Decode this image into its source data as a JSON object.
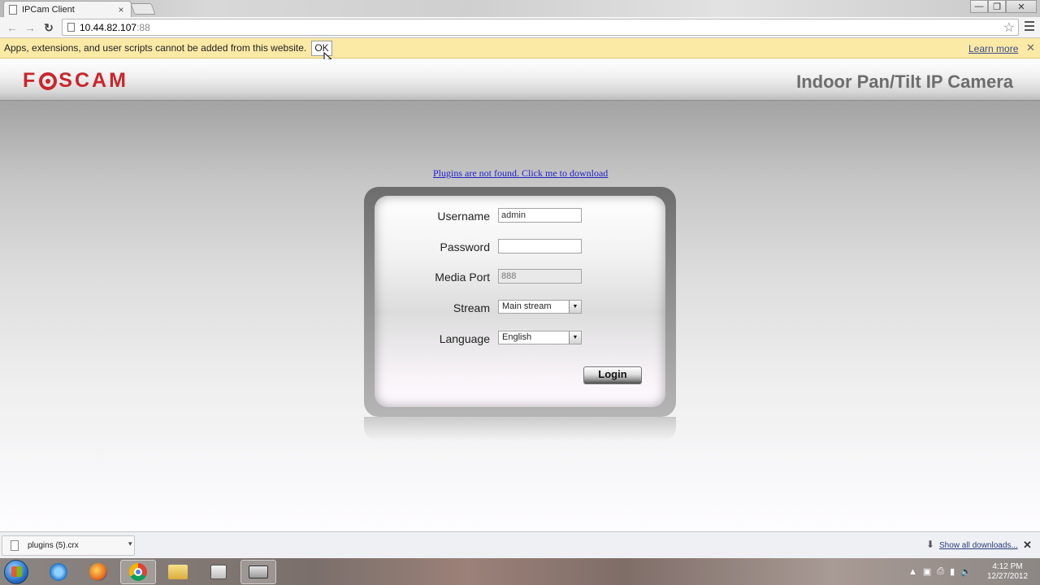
{
  "browser": {
    "tab_title": "IPCam Client",
    "tab_close": "×",
    "window_controls": {
      "minimize": "—",
      "restore": "❐",
      "close": "✕"
    },
    "url_host": "10.44.82.107",
    "url_port": ":88",
    "back": "←",
    "forward": "→",
    "reload": "↻",
    "star": "☆"
  },
  "infobar": {
    "message": "Apps, extensions, and user scripts cannot be added from this website.",
    "ok_label": "OK",
    "learn_more": "Learn more",
    "close": "✕"
  },
  "page": {
    "brand": {
      "part1": "F",
      "part2": "SCAM"
    },
    "product_title": "Indoor Pan/Tilt IP Camera",
    "plugin_link": "Plugins are not found. Click me to download",
    "login_form": {
      "username_label": "Username",
      "username_value": "admin",
      "password_label": "Password",
      "password_value": "",
      "media_port_label": "Media Port",
      "media_port_value": "888",
      "stream_label": "Stream",
      "stream_value": "Main stream",
      "language_label": "Language",
      "language_value": "English",
      "login_label": "Login"
    }
  },
  "downloads": {
    "file_name": "plugins (5).crx",
    "show_all": "Show all downloads...",
    "close": "✕"
  },
  "taskbar": {
    "clock_time": "4:12 PM",
    "clock_date": "12/27/2012",
    "tray_up": "▲"
  }
}
